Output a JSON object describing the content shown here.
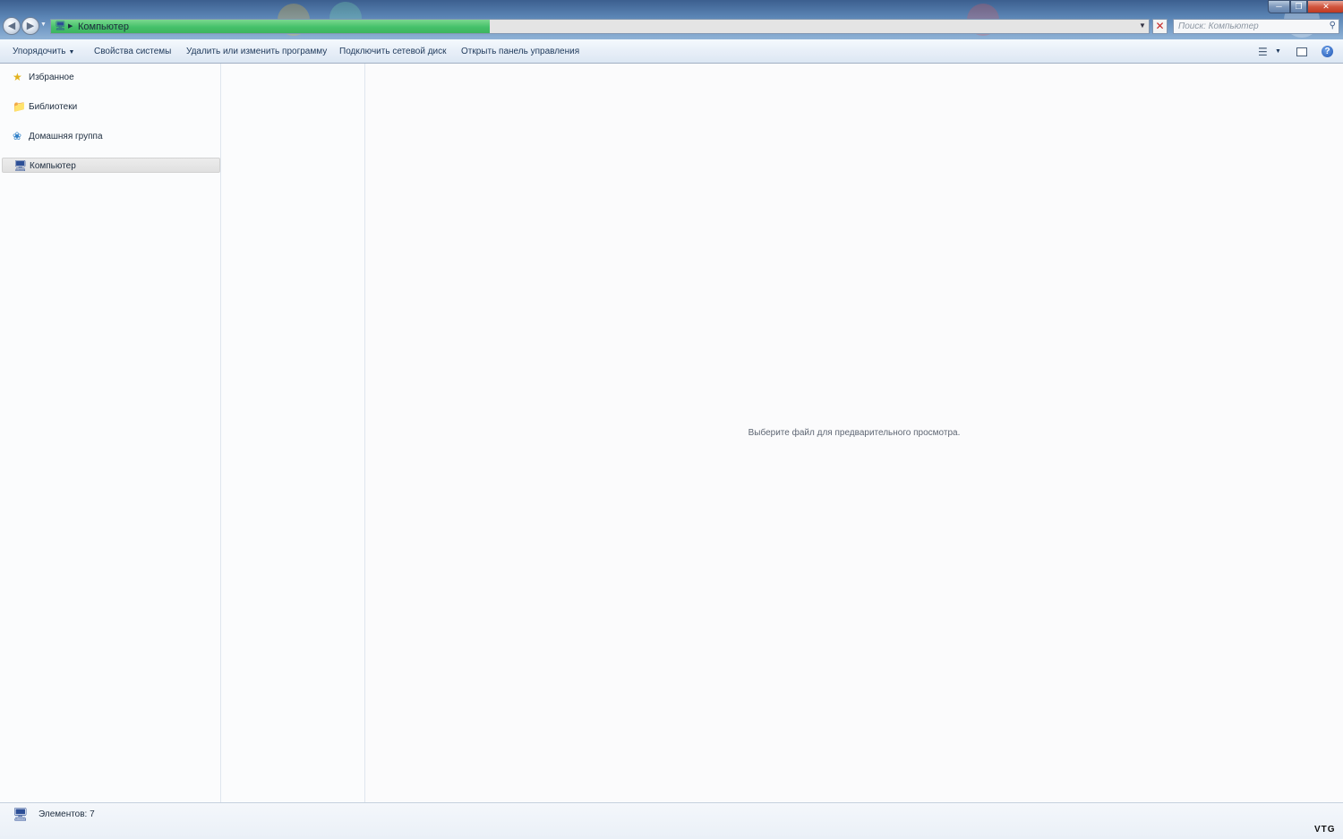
{
  "window": {
    "address": {
      "location": "Компьютер",
      "progress_pct": 40
    },
    "search": {
      "placeholder": "Поиск: Компьютер"
    }
  },
  "toolbar": {
    "organize": "Упорядочить",
    "system_properties": "Свойства системы",
    "uninstall": "Удалить или изменить программу",
    "map_drive": "Подключить сетевой диск",
    "control_panel": "Открыть панель управления"
  },
  "sidebar": {
    "items": [
      {
        "label": "Избранное",
        "icon": "star-icon"
      },
      {
        "label": "Библиотеки",
        "icon": "library-icon"
      },
      {
        "label": "Домашняя группа",
        "icon": "homegroup-icon"
      },
      {
        "label": "Компьютер",
        "icon": "computer-icon",
        "selected": true
      }
    ]
  },
  "preview": {
    "message": "Выберите файл для предварительного просмотра."
  },
  "status": {
    "items_count": "Элементов: 7"
  },
  "watermark": "VTG",
  "colors": {
    "titlebar": "#5c86b6",
    "progress": "#45c16a",
    "close_button": "#c03a22",
    "selection": "#e0e0e0"
  }
}
